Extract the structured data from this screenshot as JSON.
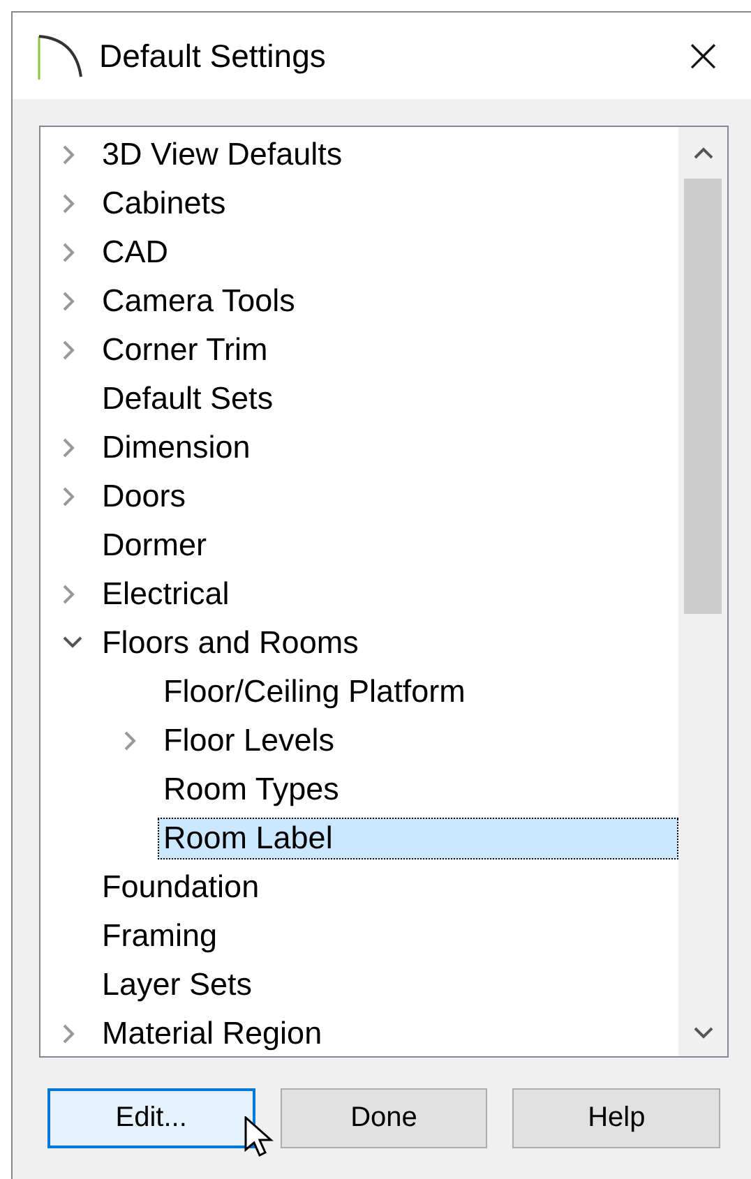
{
  "window": {
    "title": "Default Settings",
    "close_glyph": "×"
  },
  "tree": [
    {
      "label": "3D View Defaults",
      "kind": "branch",
      "expanded": false,
      "selected": false
    },
    {
      "label": "Cabinets",
      "kind": "branch",
      "expanded": false,
      "selected": false
    },
    {
      "label": "CAD",
      "kind": "branch",
      "expanded": false,
      "selected": false
    },
    {
      "label": "Camera Tools",
      "kind": "branch",
      "expanded": false,
      "selected": false
    },
    {
      "label": "Corner Trim",
      "kind": "branch",
      "expanded": false,
      "selected": false
    },
    {
      "label": "Default Sets",
      "kind": "leaf",
      "expanded": false,
      "selected": false
    },
    {
      "label": "Dimension",
      "kind": "branch",
      "expanded": false,
      "selected": false
    },
    {
      "label": "Doors",
      "kind": "branch",
      "expanded": false,
      "selected": false
    },
    {
      "label": "Dormer",
      "kind": "leaf",
      "expanded": false,
      "selected": false
    },
    {
      "label": "Electrical",
      "kind": "branch",
      "expanded": false,
      "selected": false
    },
    {
      "label": "Floors and Rooms",
      "kind": "branch",
      "expanded": true,
      "selected": false,
      "children": [
        {
          "label": "Floor/Ceiling Platform",
          "kind": "leaf",
          "expanded": false,
          "selected": false
        },
        {
          "label": "Floor Levels",
          "kind": "branch",
          "expanded": false,
          "selected": false
        },
        {
          "label": "Room Types",
          "kind": "leaf",
          "expanded": false,
          "selected": false
        },
        {
          "label": "Room Label",
          "kind": "leaf",
          "expanded": false,
          "selected": true
        }
      ]
    },
    {
      "label": "Foundation",
      "kind": "leaf",
      "expanded": false,
      "selected": false
    },
    {
      "label": "Framing",
      "kind": "leaf",
      "expanded": false,
      "selected": false
    },
    {
      "label": "Layer Sets",
      "kind": "leaf",
      "expanded": false,
      "selected": false
    },
    {
      "label": "Material Region",
      "kind": "branch",
      "expanded": false,
      "selected": false
    }
  ],
  "buttons": [
    {
      "label": "Edit...",
      "focused": true
    },
    {
      "label": "Done",
      "focused": false
    },
    {
      "label": "Help",
      "focused": false
    }
  ]
}
